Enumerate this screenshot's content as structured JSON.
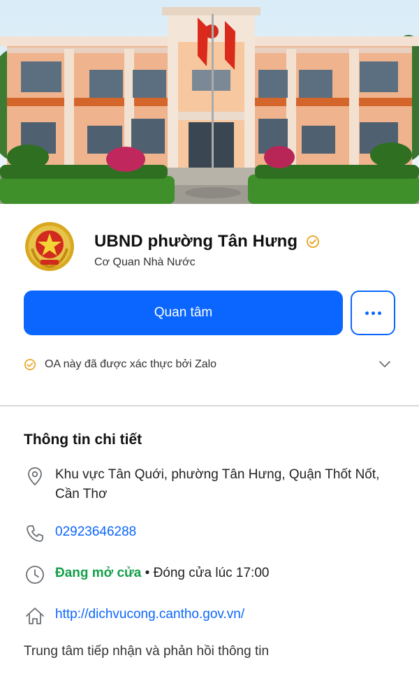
{
  "profile": {
    "name": "UBND phường Tân Hưng",
    "category": "Cơ Quan Nhà Nước",
    "follow_label": "Quan tâm",
    "more_label": "More options",
    "verification_text": "OA này đã được xác thực bởi Zalo"
  },
  "details": {
    "title": "Thông tin chi tiết",
    "address_line1": "Khu vực Tân Quới, phường Tân Hưng, Quận Thốt Nốt,",
    "address_line2": "Cần Thơ",
    "phone": "02923646288",
    "status_open": "Đang mở cửa",
    "status_separator": " • ",
    "status_close": "Đóng cửa lúc 17:00",
    "website": "http://dichvucong.cantho.gov.vn/",
    "description": "Trung tâm tiếp nhận và phản hồi thông tin"
  },
  "colors": {
    "primary": "#0a66ff",
    "open_green": "#14a04a",
    "verified_orange": "#e8a21a",
    "divider": "#d7d9dc"
  },
  "icons": {
    "cover": "building-photo",
    "emblem": "national-emblem-icon",
    "verified": "verified-check-icon",
    "more": "more-dots-icon",
    "chevron": "chevron-down-icon",
    "address": "location-pin-icon",
    "phone": "phone-icon",
    "hours": "clock-icon",
    "website": "home-icon"
  }
}
